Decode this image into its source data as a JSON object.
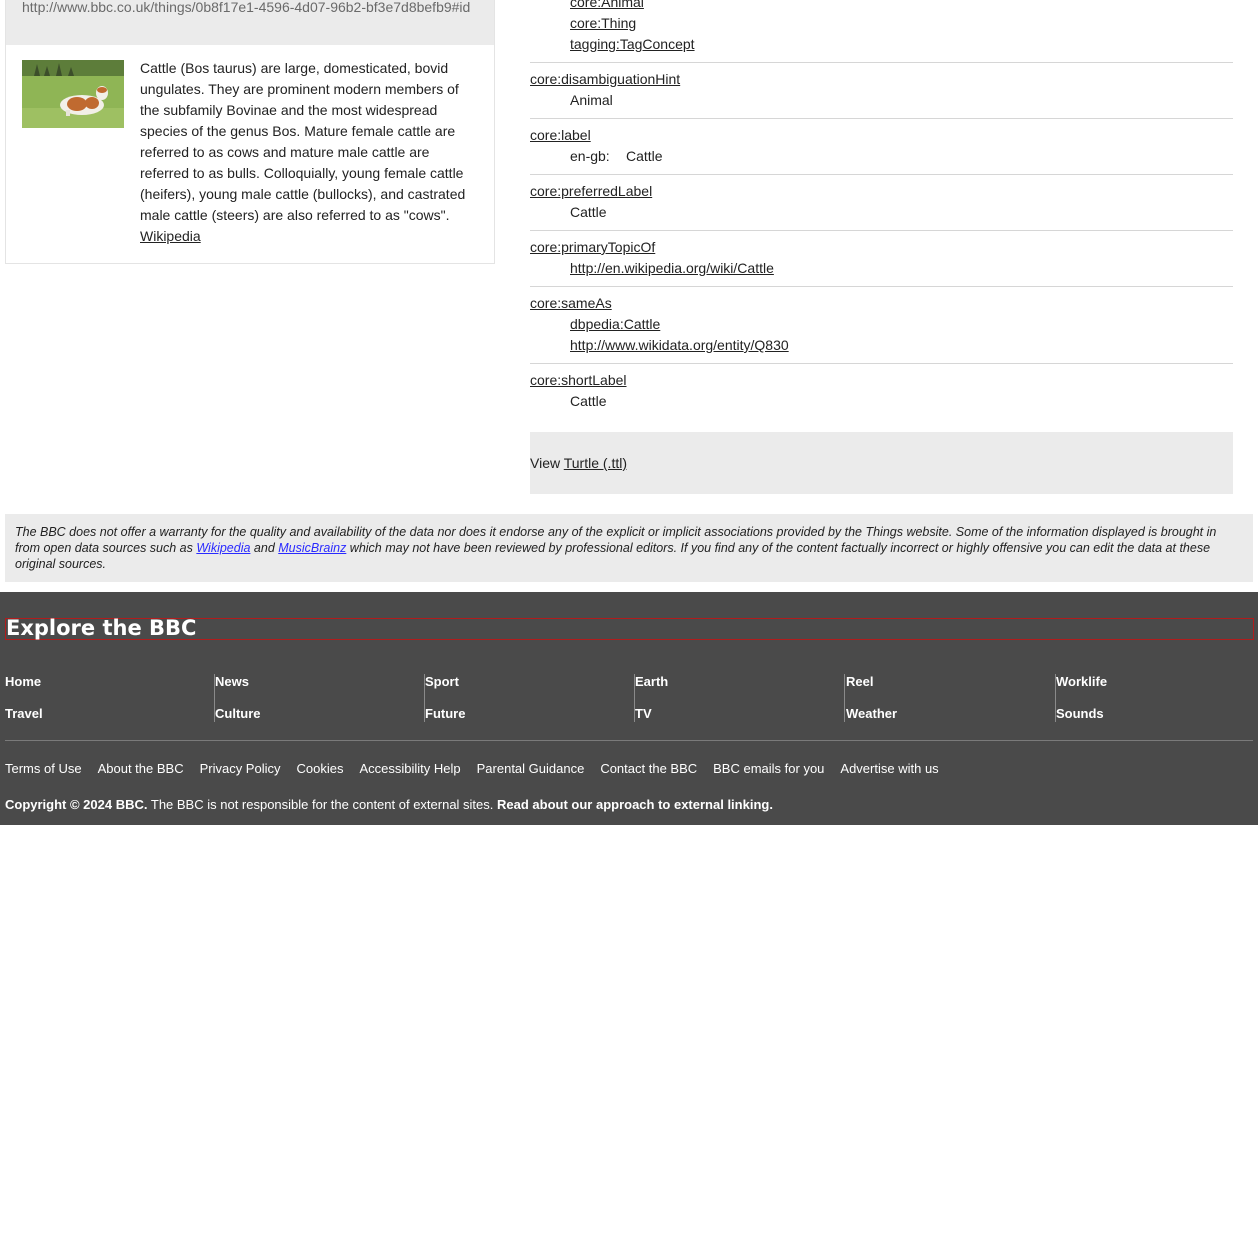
{
  "left_card": {
    "uri": "http://www.bbc.co.uk/things/0b8f17e1-4596-4d07-96b2-bf3e7d8befb9#id",
    "image_alt": "Cattle",
    "description": "Cattle (Bos taurus) are large, domesticated, bovid ungulates. They are prominent modern members of the subfamily Bovinae and the most widespread species of the genus Bos. Mature female cattle are referred to as cows and mature male cattle are referred to as bulls. Colloquially, young female cattle (heifers), young male cattle (bullocks), and castrated male cattle (steers) are also referred to as \"cows\".",
    "wikipedia_link": "Wikipedia"
  },
  "properties": {
    "type_values": [
      "core:Animal",
      "core:Thing",
      "tagging:TagConcept"
    ],
    "disambiguation": {
      "name": "core:disambiguationHint",
      "value": "Animal"
    },
    "label": {
      "name": "core:label",
      "lang": "en-gb:",
      "value": "Cattle"
    },
    "preferred_label": {
      "name": "core:preferredLabel",
      "value": "Cattle"
    },
    "primary_topic": {
      "name": "core:primaryTopicOf",
      "value": "http://en.wikipedia.org/wiki/Cattle"
    },
    "same_as": {
      "name": "core:sameAs",
      "values": [
        "dbpedia:Cattle",
        "http://www.wikidata.org/entity/Q830"
      ]
    },
    "short_label": {
      "name": "core:shortLabel",
      "value": "Cattle"
    }
  },
  "turtle": {
    "prefix": "View ",
    "link": "Turtle (.ttl)"
  },
  "disclaimer": {
    "part1": "The BBC does not offer a warranty for the quality and availability of the data nor does it endorse any of the explicit or implicit associations provided by the Things website. Some of the information displayed is brought in from open data sources such as ",
    "link_wikipedia": "Wikipedia",
    "part2": " and ",
    "link_musicbrainz": "MusicBrainz",
    "part3": " which may not have been reviewed by professional editors. If you find any of the content factually incorrect or highly offensive you can edit the data at these original sources."
  },
  "footer": {
    "explore_title": "Explore the BBC",
    "nav": [
      [
        "Home",
        "Travel"
      ],
      [
        "News",
        "Culture"
      ],
      [
        "Sport",
        "Future"
      ],
      [
        "Earth",
        "TV"
      ],
      [
        "Reel",
        "Weather"
      ],
      [
        "Worklife",
        "Sounds"
      ]
    ],
    "legal_links": [
      "Terms of Use",
      "About the BBC",
      "Privacy Policy",
      "Cookies",
      "Accessibility Help",
      "Parental Guidance",
      "Contact the BBC",
      "BBC emails for you",
      "Advertise with us"
    ],
    "copyright_bold": "Copyright © 2024 BBC.",
    "copyright_text": " The BBC is not responsible for the content of external sites. ",
    "copyright_link": "Read about our approach to external linking."
  },
  "colors": {
    "footer_bg": "#4a4a4a",
    "panel_bg": "#ebebeb",
    "explore_border": "#b11c1c",
    "disclaimer_link": "#2a2aff"
  }
}
